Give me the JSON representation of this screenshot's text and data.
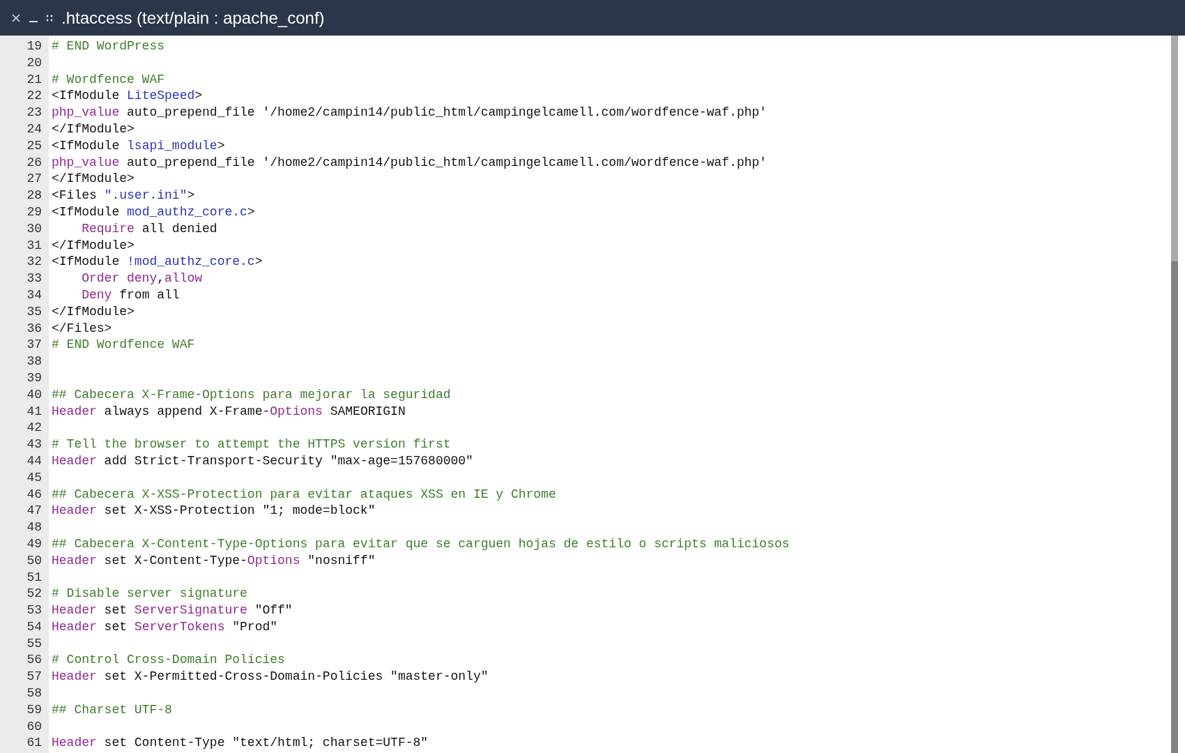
{
  "window": {
    "title": ".htaccess (text/plain : apache_conf)"
  },
  "lines": [
    {
      "number": "19",
      "tokens": [
        {
          "kind": "comment",
          "text": "# END WordPress"
        }
      ]
    },
    {
      "number": "20"
    },
    {
      "number": "21",
      "tokens": [
        {
          "kind": "comment",
          "text": "# Wordfence WAF"
        }
      ]
    },
    {
      "number": "22",
      "tokens": [
        {
          "kind": "plain",
          "text": "<IfModule "
        },
        {
          "kind": "value",
          "text": "LiteSpeed"
        },
        {
          "kind": "plain",
          "text": ">"
        }
      ]
    },
    {
      "number": "23",
      "tokens": [
        {
          "kind": "keyword",
          "text": "php_value"
        },
        {
          "kind": "plain",
          "text": " auto_prepend_file '/home2/campin14/public_html/campingelcamell.com/wordfence-waf.php'"
        }
      ]
    },
    {
      "number": "24",
      "tokens": [
        {
          "kind": "plain",
          "text": "</IfModule>"
        }
      ]
    },
    {
      "number": "25",
      "tokens": [
        {
          "kind": "plain",
          "text": "<IfModule "
        },
        {
          "kind": "value",
          "text": "lsapi_module"
        },
        {
          "kind": "plain",
          "text": ">"
        }
      ]
    },
    {
      "number": "26",
      "tokens": [
        {
          "kind": "keyword",
          "text": "php_value"
        },
        {
          "kind": "plain",
          "text": " auto_prepend_file '/home2/campin14/public_html/campingelcamell.com/wordfence-waf.php'"
        }
      ]
    },
    {
      "number": "27",
      "tokens": [
        {
          "kind": "plain",
          "text": "</IfModule>"
        }
      ]
    },
    {
      "number": "28",
      "tokens": [
        {
          "kind": "plain",
          "text": "<Files "
        },
        {
          "kind": "value",
          "text": "\".user.ini\""
        },
        {
          "kind": "plain",
          "text": ">"
        }
      ]
    },
    {
      "number": "29",
      "tokens": [
        {
          "kind": "plain",
          "text": "<IfModule "
        },
        {
          "kind": "value",
          "text": "mod_authz_core.c"
        },
        {
          "kind": "plain",
          "text": ">"
        }
      ]
    },
    {
      "number": "30",
      "tokens": [
        {
          "kind": "keyword",
          "text": "    Require"
        },
        {
          "kind": "plain",
          "text": " all denied"
        }
      ]
    },
    {
      "number": "31",
      "tokens": [
        {
          "kind": "plain",
          "text": "</IfModule>"
        }
      ]
    },
    {
      "number": "32",
      "tokens": [
        {
          "kind": "plain",
          "text": "<IfModule "
        },
        {
          "kind": "value",
          "text": "!mod_authz_core.c"
        },
        {
          "kind": "plain",
          "text": ">"
        }
      ]
    },
    {
      "number": "33",
      "tokens": [
        {
          "kind": "keyword",
          "text": "    Order deny"
        },
        {
          "kind": "plain",
          "text": ","
        },
        {
          "kind": "keyword",
          "text": "allow"
        }
      ]
    },
    {
      "number": "34",
      "tokens": [
        {
          "kind": "keyword",
          "text": "    Deny"
        },
        {
          "kind": "plain",
          "text": " from all"
        }
      ]
    },
    {
      "number": "35",
      "tokens": [
        {
          "kind": "plain",
          "text": "</IfModule>"
        }
      ]
    },
    {
      "number": "36",
      "tokens": [
        {
          "kind": "plain",
          "text": "</Files>"
        }
      ]
    },
    {
      "number": "37",
      "tokens": [
        {
          "kind": "comment",
          "text": "# END Wordfence WAF"
        }
      ]
    },
    {
      "number": "38"
    },
    {
      "number": "39"
    },
    {
      "number": "40",
      "tokens": [
        {
          "kind": "comment",
          "text": "## Cabecera X-Frame-Options para mejorar la seguridad"
        }
      ]
    },
    {
      "number": "41",
      "tokens": [
        {
          "kind": "keyword",
          "text": "Header"
        },
        {
          "kind": "plain",
          "text": " always append X-Frame-"
        },
        {
          "kind": "keyword",
          "text": "Options"
        },
        {
          "kind": "plain",
          "text": " SAMEORIGIN"
        }
      ]
    },
    {
      "number": "42"
    },
    {
      "number": "43",
      "tokens": [
        {
          "kind": "comment",
          "text": "# Tell the browser to attempt the HTTPS version first"
        }
      ]
    },
    {
      "number": "44",
      "tokens": [
        {
          "kind": "keyword",
          "text": "Header"
        },
        {
          "kind": "plain",
          "text": " add Strict-Transport-Security \"max-age=157680000\""
        }
      ]
    },
    {
      "number": "45"
    },
    {
      "number": "46",
      "tokens": [
        {
          "kind": "comment",
          "text": "## Cabecera X-XSS-Protection para evitar ataques XSS en IE y Chrome"
        }
      ]
    },
    {
      "number": "47",
      "tokens": [
        {
          "kind": "keyword",
          "text": "Header"
        },
        {
          "kind": "plain",
          "text": " set X-XSS-Protection \"1; mode=block\""
        }
      ]
    },
    {
      "number": "48"
    },
    {
      "number": "49",
      "tokens": [
        {
          "kind": "comment",
          "text": "## Cabecera X-Content-Type-Options para evitar que se carguen hojas de estilo o scripts maliciosos"
        }
      ]
    },
    {
      "number": "50",
      "tokens": [
        {
          "kind": "keyword",
          "text": "Header"
        },
        {
          "kind": "plain",
          "text": " set X-Content-Type-"
        },
        {
          "kind": "keyword",
          "text": "Options"
        },
        {
          "kind": "plain",
          "text": " \"nosniff\""
        }
      ]
    },
    {
      "number": "51"
    },
    {
      "number": "52",
      "tokens": [
        {
          "kind": "comment",
          "text": "# Disable server signature"
        }
      ]
    },
    {
      "number": "53",
      "tokens": [
        {
          "kind": "keyword",
          "text": "Header"
        },
        {
          "kind": "plain",
          "text": " set "
        },
        {
          "kind": "keyword",
          "text": "ServerSignature"
        },
        {
          "kind": "plain",
          "text": " \"Off\""
        }
      ]
    },
    {
      "number": "54",
      "tokens": [
        {
          "kind": "keyword",
          "text": "Header"
        },
        {
          "kind": "plain",
          "text": " set "
        },
        {
          "kind": "keyword",
          "text": "ServerTokens"
        },
        {
          "kind": "plain",
          "text": " \"Prod\""
        }
      ]
    },
    {
      "number": "55"
    },
    {
      "number": "56",
      "tokens": [
        {
          "kind": "comment",
          "text": "# Control Cross-Domain Policies"
        }
      ]
    },
    {
      "number": "57",
      "tokens": [
        {
          "kind": "keyword",
          "text": "Header"
        },
        {
          "kind": "plain",
          "text": " set X-Permitted-Cross-Domain-Policies \"master-only\""
        }
      ]
    },
    {
      "number": "58"
    },
    {
      "number": "59",
      "tokens": [
        {
          "kind": "comment",
          "text": "## Charset UTF-8"
        }
      ]
    },
    {
      "number": "60"
    },
    {
      "number": "61",
      "tokens": [
        {
          "kind": "keyword",
          "text": "Header"
        },
        {
          "kind": "plain",
          "text": " set Content-Type \"text/html; charset=UTF-8\""
        }
      ]
    }
  ]
}
